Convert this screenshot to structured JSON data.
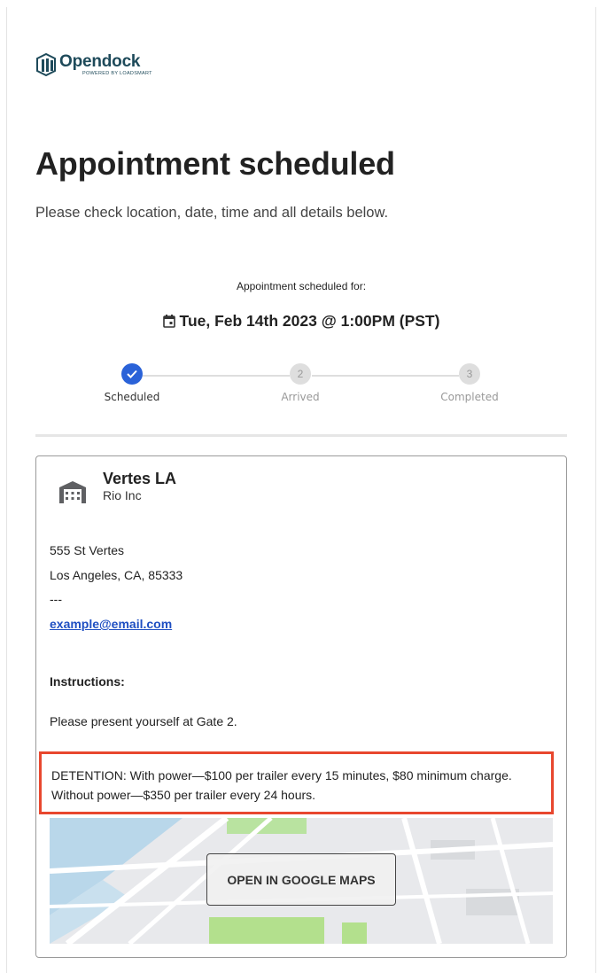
{
  "brand": {
    "name": "Opendock",
    "tagline": "POWERED BY LOADSMART",
    "color": "#1e4a5a"
  },
  "header": {
    "title": "Appointment scheduled",
    "subtitle": "Please check location, date, time and all details below."
  },
  "appointment": {
    "label": "Appointment scheduled for:",
    "datetime": "Tue, Feb 14th 2023 @ 1:00PM (PST)"
  },
  "steps": [
    {
      "label": "Scheduled",
      "number": "",
      "state": "done"
    },
    {
      "label": "Arrived",
      "number": "2",
      "state": "todo"
    },
    {
      "label": "Completed",
      "number": "3",
      "state": "todo"
    }
  ],
  "warehouse": {
    "name": "Vertes LA",
    "org": "Rio Inc",
    "address_line1": "555 St Vertes",
    "address_line2": "Los Angeles, CA, 85333",
    "separator": "---",
    "email": "example@email.com"
  },
  "instructions": {
    "heading": "Instructions:",
    "text": "Please present yourself at Gate 2.",
    "detention_line1": "DETENTION: With power—$100 per trailer every 15 minutes, $80 minimum charge.",
    "detention_line2": "Without power—$350 per trailer every 24 hours."
  },
  "map": {
    "button_label": "OPEN IN GOOGLE MAPS"
  },
  "colors": {
    "accent_blue": "#2a62d8",
    "highlight_red": "#e8472e",
    "link": "#1f4fc2"
  }
}
